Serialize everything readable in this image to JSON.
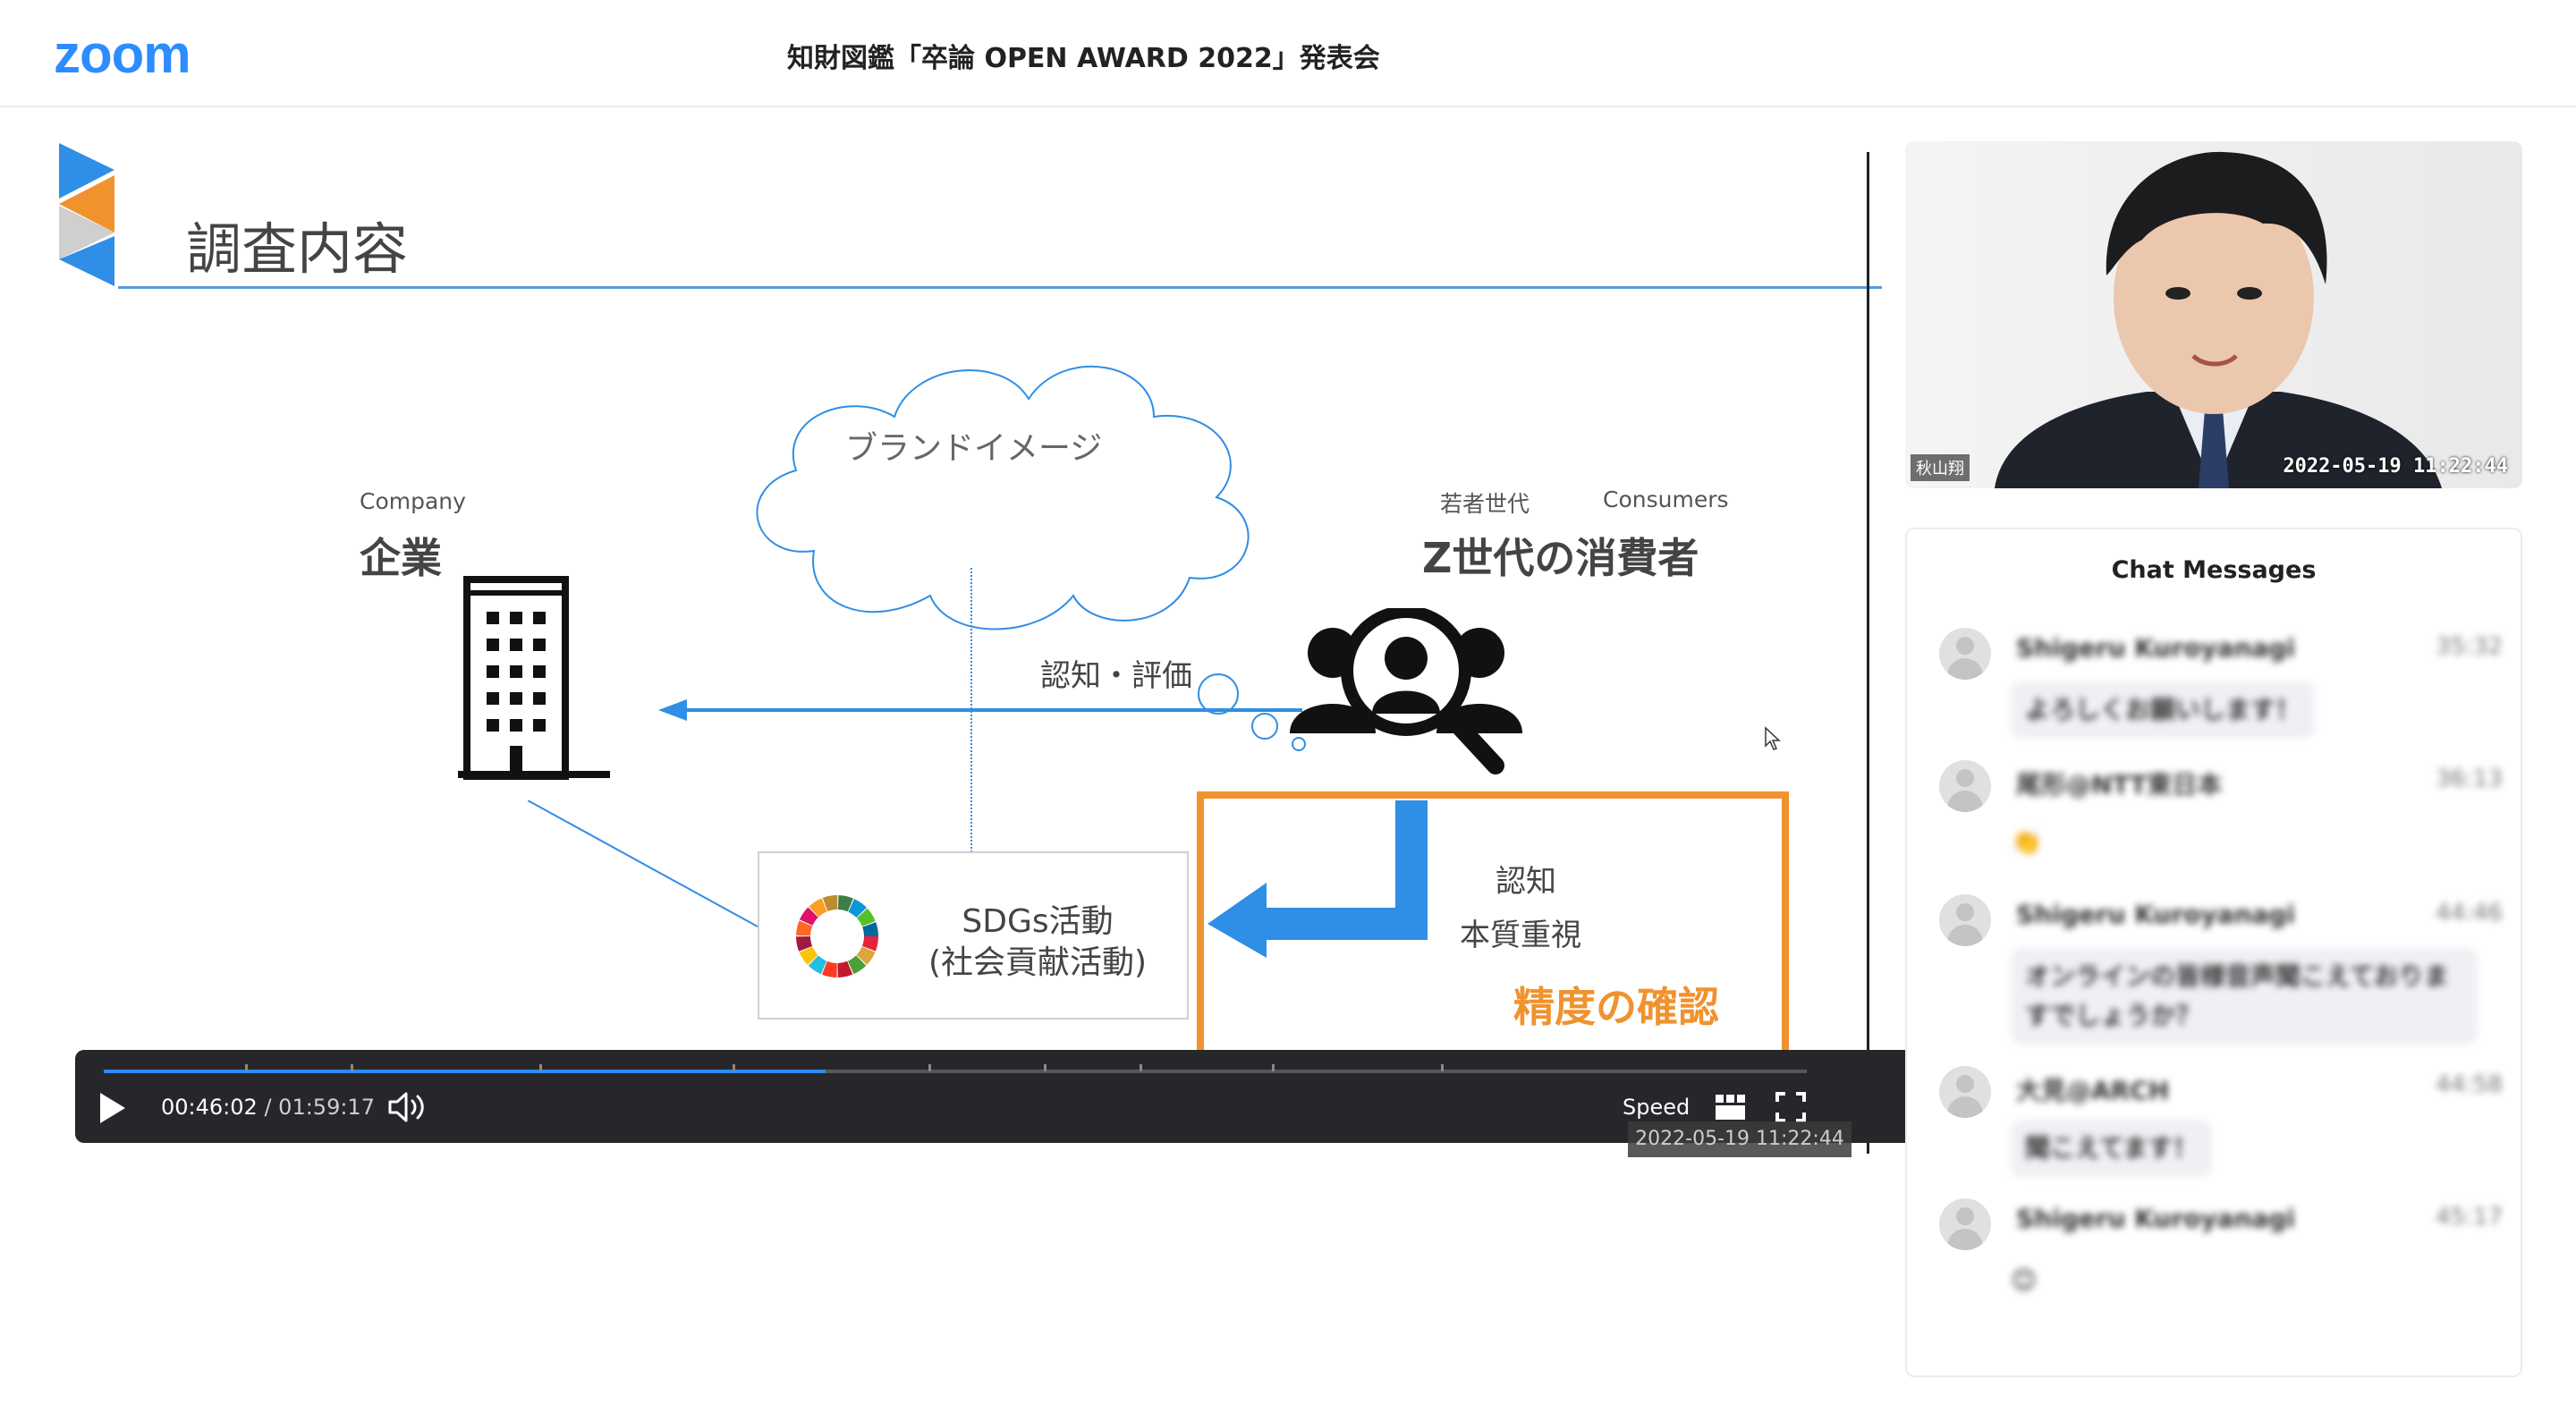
{
  "app": {
    "logo": "zoom",
    "title": "知財図鑑「卒論 OPEN AWARD 2022」発表会"
  },
  "slide": {
    "heading": "調査内容",
    "cloud_text": "ブランドイメージ",
    "company_en": "Company",
    "company_jp": "企業",
    "consumer_sub_jp": "若者世代",
    "consumer_sub_en": "Consumers",
    "consumer_jp": "Z世代の消費者",
    "arrow_label": "認知・評価",
    "sdgs_line1": "SDGs活動",
    "sdgs_line2": "(社会貢献活動)",
    "box_line1": "認知",
    "box_line2": "本質重視",
    "box_emphasis": "精度の確認"
  },
  "player": {
    "current_time": "00:46:02",
    "separator": "/",
    "duration": "01:59:17",
    "progress": 0.424,
    "speed_label": "Speed",
    "timestamp_overlay": "2022-05-19 11:22:44"
  },
  "camera": {
    "name": "秋山翔",
    "timestamp": "2022-05-19  11:22:44"
  },
  "chat": {
    "title": "Chat Messages",
    "messages": [
      {
        "name": "Shigeru Kuroyanagi",
        "time": "35:32",
        "text": "よろしくお願いします！"
      },
      {
        "name": "尾形@NTT東日本",
        "time": "36:13",
        "text": "👏"
      },
      {
        "name": "Shigeru Kuroyanagi",
        "time": "44:46",
        "text": "オンラインの皆様音声聞こえておりますでしょうか？"
      },
      {
        "name": "大見@ARCH",
        "time": "44:58",
        "text": "聞こえてます！"
      },
      {
        "name": "Shigeru Kuroyanagi",
        "time": "45:17",
        "text": "😊"
      }
    ]
  },
  "colors": {
    "accent": "#2d8cff",
    "orange": "#f0922e",
    "slide_blue": "#2f8ee5"
  }
}
